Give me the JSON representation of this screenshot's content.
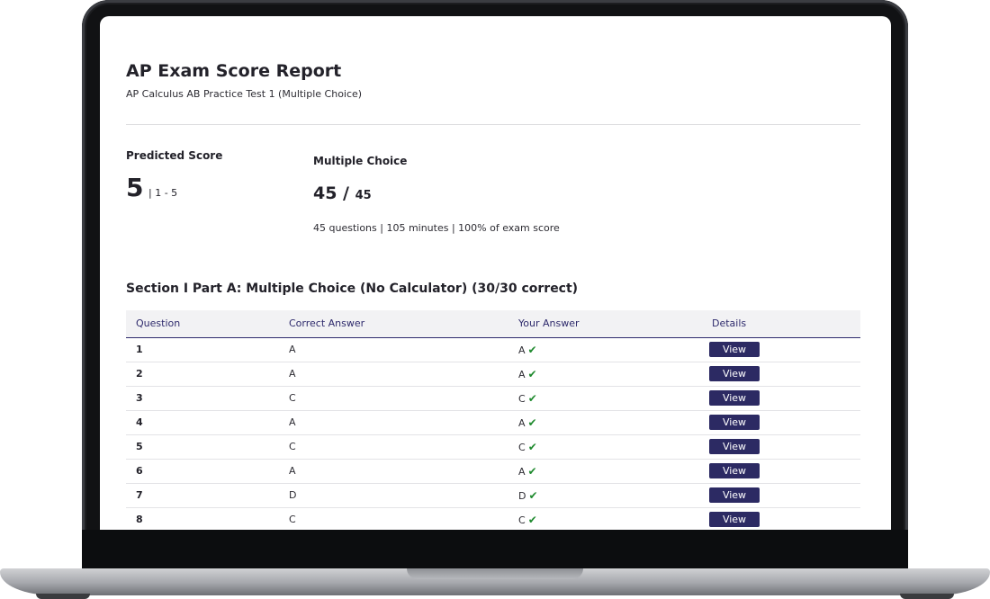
{
  "report": {
    "title": "AP Exam Score Report",
    "subtitle": "AP Calculus AB Practice Test 1 (Multiple Choice)"
  },
  "predicted": {
    "label": "Predicted Score",
    "value": "5",
    "range": "| 1 - 5"
  },
  "multiple_choice": {
    "label": "Multiple Choice",
    "score": "45 /",
    "total": "45",
    "info": "45 questions | 105 minutes | 100% of exam score"
  },
  "section": {
    "title": "Section I Part A: Multiple Choice (No Calculator) (30/30 correct)",
    "headers": [
      "Question",
      "Correct Answer",
      "Your Answer",
      "Details"
    ],
    "rows": [
      {
        "q": "1",
        "correct": "A",
        "yours": "A",
        "details": "View"
      },
      {
        "q": "2",
        "correct": "A",
        "yours": "A",
        "details": "View"
      },
      {
        "q": "3",
        "correct": "C",
        "yours": "C",
        "details": "View"
      },
      {
        "q": "4",
        "correct": "A",
        "yours": "A",
        "details": "View"
      },
      {
        "q": "5",
        "correct": "C",
        "yours": "C",
        "details": "View"
      },
      {
        "q": "6",
        "correct": "A",
        "yours": "A",
        "details": "View"
      },
      {
        "q": "7",
        "correct": "D",
        "yours": "D",
        "details": "View"
      },
      {
        "q": "8",
        "correct": "C",
        "yours": "C",
        "details": "View"
      }
    ]
  },
  "colors": {
    "accent": "#2c2a63",
    "correct": "#1f8a2e"
  },
  "icons": {
    "correct": "checkmark-icon"
  }
}
